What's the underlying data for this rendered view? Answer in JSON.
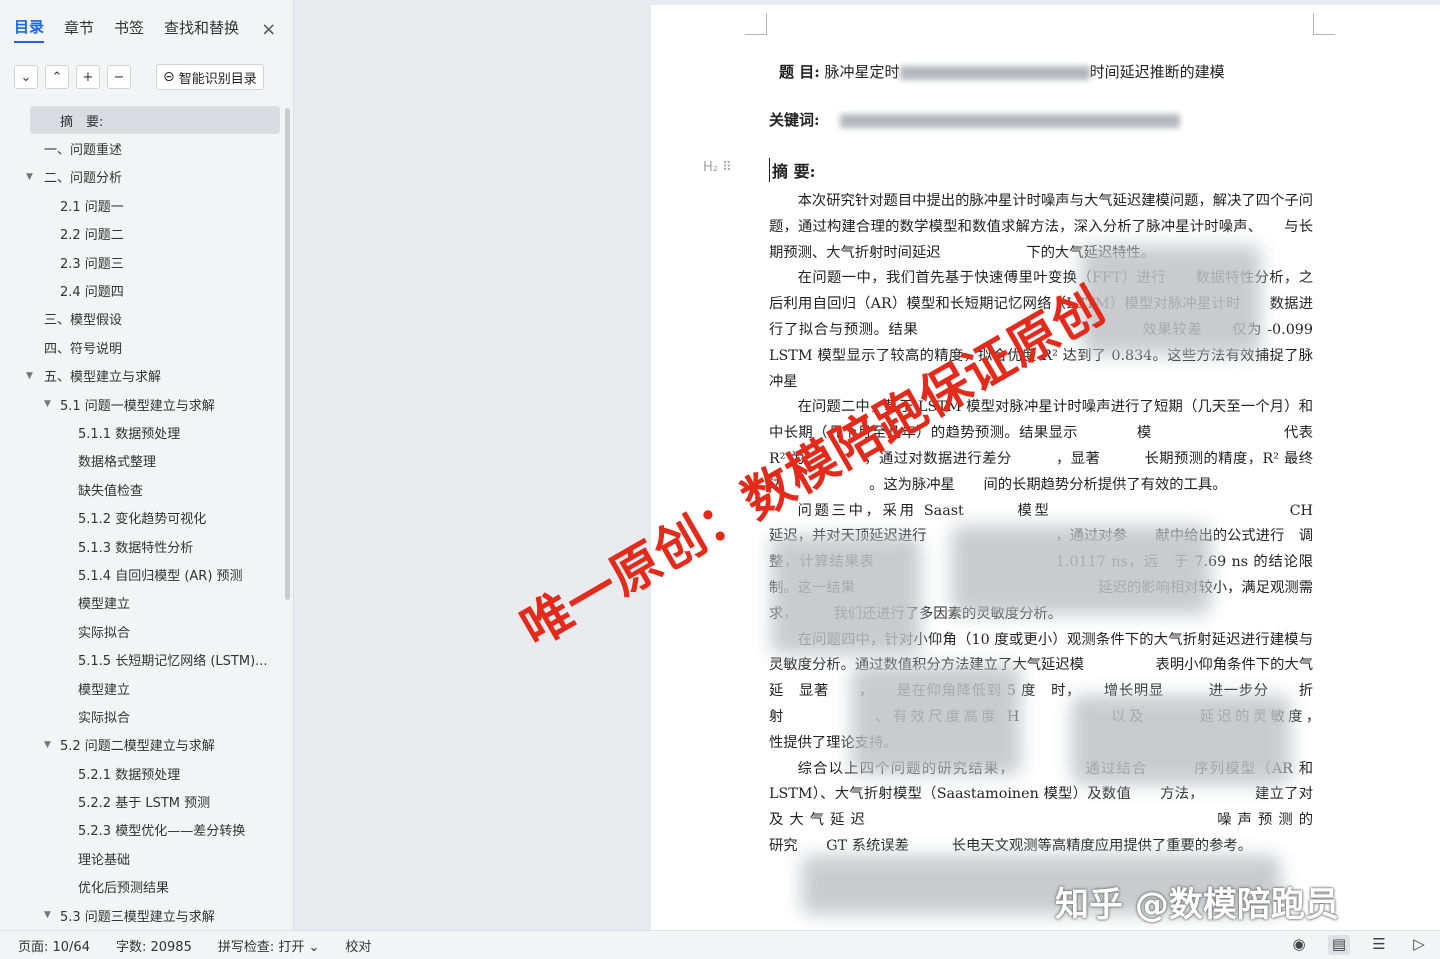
{
  "nav": {
    "tabs": [
      "目录",
      "章节",
      "书签",
      "查找和替换"
    ],
    "close_icon": "×",
    "tools": {
      "down": "⌄",
      "up": "⌃",
      "plus": "+",
      "minus": "−",
      "smart_label": "智能识别目录"
    },
    "toc": [
      {
        "label": "摘　要:",
        "level": 1,
        "caret": ""
      },
      {
        "label": "一、问题重述",
        "level": 1,
        "caret": ""
      },
      {
        "label": "二、问题分析",
        "level": 1,
        "caret": "▼"
      },
      {
        "label": "2.1 问题一",
        "level": 2,
        "caret": ""
      },
      {
        "label": "2.2 问题二",
        "level": 2,
        "caret": ""
      },
      {
        "label": "2.3 问题三",
        "level": 2,
        "caret": ""
      },
      {
        "label": "2.4 问题四",
        "level": 2,
        "caret": ""
      },
      {
        "label": "三、模型假设",
        "level": 1,
        "caret": ""
      },
      {
        "label": "四、符号说明",
        "level": 1,
        "caret": ""
      },
      {
        "label": "五、模型建立与求解",
        "level": 1,
        "caret": "▼"
      },
      {
        "label": "5.1 问题一模型建立与求解",
        "level": 2,
        "caret": "▼"
      },
      {
        "label": "5.1.1  数据预处理",
        "level": 3,
        "caret": ""
      },
      {
        "label": "数据格式整理",
        "level": 3,
        "caret": ""
      },
      {
        "label": "缺失值检查",
        "level": 3,
        "caret": ""
      },
      {
        "label": "5.1.2  变化趋势可视化",
        "level": 3,
        "caret": ""
      },
      {
        "label": "5.1.3  数据特性分析",
        "level": 3,
        "caret": ""
      },
      {
        "label": "5.1.4  自回归模型 (AR) 预测",
        "level": 3,
        "caret": ""
      },
      {
        "label": "模型建立",
        "level": 3,
        "caret": ""
      },
      {
        "label": "实际拟合",
        "level": 3,
        "caret": ""
      },
      {
        "label": "5.1.5  长短期记忆网络 (LSTM)...",
        "level": 3,
        "caret": ""
      },
      {
        "label": "模型建立",
        "level": 3,
        "caret": ""
      },
      {
        "label": "实际拟合",
        "level": 3,
        "caret": ""
      },
      {
        "label": "5.2 问题二模型建立与求解",
        "level": 2,
        "caret": "▼"
      },
      {
        "label": "5.2.1  数据预处理",
        "level": 3,
        "caret": ""
      },
      {
        "label": "5.2.2  基于 LSTM 预测",
        "level": 3,
        "caret": ""
      },
      {
        "label": "5.2.3    模型优化——差分转换",
        "level": 3,
        "caret": ""
      },
      {
        "label": "理论基础",
        "level": 3,
        "caret": ""
      },
      {
        "label": "优化后预测结果",
        "level": 3,
        "caret": ""
      },
      {
        "label": "5.3 问题三模型建立与求解",
        "level": 2,
        "caret": "▼"
      }
    ]
  },
  "doc": {
    "title_label": "题  目:",
    "title_start": "脉冲星定时",
    "title_end": "时间延迟推断的建模",
    "keywords_label": "关键词:",
    "heading_marker": "H₂ ⠿",
    "abstract_label": "摘    要:",
    "paragraphs": [
      "本次研究针对题目中提出的脉冲星计时噪声与大气延迟建模问题，解决了四个子问题，通过构建合理的数学模型和数值求解方法，深入分析了脉冲星计时噪声、　　与长期预测、大气折射时间延迟　　　　　　下的大气延迟特性。",
      "在问题一中，我们首先基于快速傅里叶变换（FFT）进行　　数据特性分析，之后利用自回归（AR）模型和长短期记忆网络（LSTM）模型对脉冲星计时　　数据进行了拟合与预测。结果　　　　　　　　　　　　　　　效果较差　　仅为 -0.099　　　　LSTM 模型显示了较高的精度，拟合优度 R² 达到了 0.834。这些方法有效捕捉了脉冲星　　　　　　　　　　",
      "在问题二中，基于 LSTM 模型对脉冲星计时噪声进行了短期（几天至一个月）和中长期（几个月至几年）的趋势预测。结果显示　　　　模　　　　　　　　　代表　　　　　　R² 为　　　　，通过对数据进行差分　　　，显著　　　长期预测的精度，R² 最终达　　　　　　。这为脉冲星　　间的长期趋势分析提供了有效的工具。",
      "问题三中，采用 Saast　　　模型　　　　　　　　　　　　　　CH　　　　　延迟，并对天顶延迟进行　　　　　　　　　，通过对参　　献中给出的公式进行　调整，计算结果表　　　　　　　　　　　　1.0117 ns，远　于 7.69 ns 的结论限制。这一结果　　　　　　　　　　　　　　　　　延迟的影响相对较小，满足观测需求，　　　我们还进行了多因素的灵敏度分析。",
      "在问题四中，针对小仰角（10 度或更小）观测条件下的大气折射延迟进行建模与灵敏度分析。通过数值积分方法建立了大气延迟模　　　　　表明小仰角条件下的大气延　显著　　，　　是在仰角降低到 5 度　时，　　增长明显　　　进一步分　　折射　　　　　、有效尺度高度 H　　　　　以及　　　延迟的灵敏度，　　　　　　　　　　　　　　　　　　　　　　性提供了理论支持。",
      "综合以上四个问题的研究结果，　　　　　通过结合　　　序列模型（AR 和 LSTM）、大气折射模型（Saastamoinen 模型）及数值　　方法，　　　　建立了对　　　　　　　　　及大气延迟　　　　　　　　　　　　　　　　　噪声预测的　　　　　　　　　　　　　研究　　GT 系统误差　　　长电天文观测等高精度应用提供了重要的参考。"
    ]
  },
  "watermarks": {
    "main": "唯一原创：数模陪跑保证原创",
    "corner": "知乎 @数模陪跑员"
  },
  "status": {
    "page": "页面: 10/64",
    "words": "字数: 20985",
    "spell": "拼写检查: 打开 ⌄",
    "proof": "校对",
    "icons": [
      "eye-icon",
      "page-view-icon",
      "outline-view-icon",
      "play-icon"
    ]
  },
  "colors": {
    "accent": "#1a66e8",
    "watermark": "#e32a1b"
  }
}
